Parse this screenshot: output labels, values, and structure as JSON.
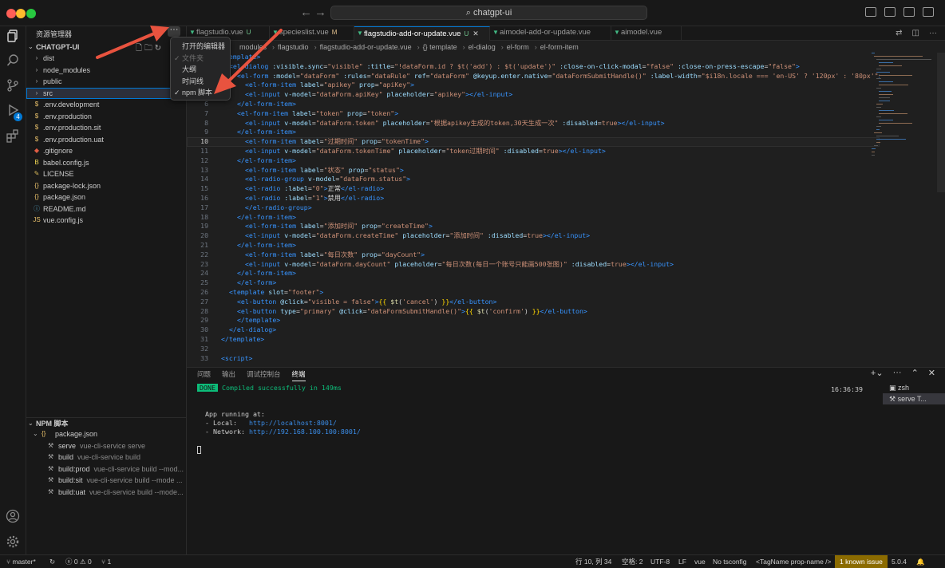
{
  "window": {
    "title": "chatgpt-ui"
  },
  "sidebar": {
    "title": "资源管理器",
    "more_label": "···",
    "project": "CHATGPT-UI",
    "tree": [
      {
        "name": "dist",
        "kind": "folder"
      },
      {
        "name": "node_modules",
        "kind": "folder"
      },
      {
        "name": "public",
        "kind": "folder"
      },
      {
        "name": "src",
        "kind": "folder",
        "selected": true
      },
      {
        "name": ".env.development",
        "kind": "env"
      },
      {
        "name": ".env.production",
        "kind": "env"
      },
      {
        "name": ".env.production.sit",
        "kind": "env"
      },
      {
        "name": ".env.production.uat",
        "kind": "env"
      },
      {
        "name": ".gitignore",
        "kind": "git"
      },
      {
        "name": "babel.config.js",
        "kind": "babel"
      },
      {
        "name": "LICENSE",
        "kind": "license"
      },
      {
        "name": "package-lock.json",
        "kind": "json"
      },
      {
        "name": "package.json",
        "kind": "json"
      },
      {
        "name": "README.md",
        "kind": "info"
      },
      {
        "name": "vue.config.js",
        "kind": "js"
      }
    ],
    "npm": {
      "title": "NPM 脚本",
      "package": "package.json",
      "scripts": [
        {
          "name": "serve",
          "cmd": "vue-cli-service serve"
        },
        {
          "name": "build",
          "cmd": "vue-cli-service build"
        },
        {
          "name": "build:prod",
          "cmd": "vue-cli-service build --mod..."
        },
        {
          "name": "build:sit",
          "cmd": "vue-cli-service build --mode ..."
        },
        {
          "name": "build:uat",
          "cmd": "vue-cli-service build --mode..."
        }
      ]
    }
  },
  "context_menu": {
    "items": [
      {
        "label": "打开的编辑器",
        "checked": false,
        "disabled": false
      },
      {
        "label": "文件夹",
        "checked": true,
        "disabled": true
      },
      {
        "label": "大纲",
        "checked": false,
        "disabled": false
      },
      {
        "label": "时间线",
        "checked": false,
        "disabled": false
      },
      {
        "label": "npm 脚本",
        "checked": true,
        "disabled": false
      }
    ]
  },
  "tabs": [
    {
      "label": "flagstudio.vue",
      "mark": "U",
      "active": false
    },
    {
      "label": "specieslist.vue",
      "mark": "M",
      "active": false
    },
    {
      "label": "flagstudio-add-or-update.vue",
      "mark": "U",
      "active": true,
      "close": "✕"
    },
    {
      "label": "aimodel-add-or-update.vue",
      "mark": "",
      "active": false
    },
    {
      "label": "aimodel.vue",
      "mark": "",
      "active": false
    }
  ],
  "breadcrumb": [
    "modules",
    "flagstudio",
    "flagstudio-add-or-update.vue",
    "{} template",
    "el-dialog",
    "el-form",
    "el-form-item"
  ],
  "editor": {
    "current_line": 10,
    "lines": [
      {
        "n": 1,
        "i": 0,
        "t": [
          [
            "t",
            "<template>"
          ]
        ]
      },
      {
        "n": 2,
        "i": 1,
        "t": [
          [
            "t",
            "<el-dialog "
          ],
          [
            "a",
            ":visible.sync"
          ],
          [
            "x",
            "="
          ],
          [
            "s",
            "\"visible\" "
          ],
          [
            "a",
            ":title"
          ],
          [
            "x",
            "="
          ],
          [
            "s",
            "\"!dataForm.id ? $t('add') : $t('update')\" "
          ],
          [
            "a",
            ":close-on-click-modal"
          ],
          [
            "x",
            "="
          ],
          [
            "s",
            "\"false\" "
          ],
          [
            "a",
            ":close-on-press-escape"
          ],
          [
            "x",
            "="
          ],
          [
            "s",
            "\"false\""
          ],
          [
            "t",
            ">"
          ]
        ]
      },
      {
        "n": 3,
        "i": 2,
        "t": [
          [
            "t",
            "<el-form "
          ],
          [
            "a",
            ":model"
          ],
          [
            "x",
            "="
          ],
          [
            "s",
            "\"dataForm\" "
          ],
          [
            "a",
            ":rules"
          ],
          [
            "x",
            "="
          ],
          [
            "s",
            "\"dataRule\" "
          ],
          [
            "a",
            "ref"
          ],
          [
            "x",
            "="
          ],
          [
            "s",
            "\"dataForm\" "
          ],
          [
            "a",
            "@keyup.enter.native"
          ],
          [
            "x",
            "="
          ],
          [
            "s",
            "\"dataFormSubmitHandle()\" "
          ],
          [
            "a",
            ":label-width"
          ],
          [
            "x",
            "="
          ],
          [
            "s",
            "\"$i18n.locale === 'en-US' ? '120px' : '80px'\""
          ],
          [
            "t",
            ">"
          ]
        ]
      },
      {
        "n": 4,
        "i": 3,
        "t": [
          [
            "t",
            "<el-form-item "
          ],
          [
            "a",
            "label"
          ],
          [
            "x",
            "="
          ],
          [
            "s",
            "\"apikey\" "
          ],
          [
            "a",
            "prop"
          ],
          [
            "x",
            "="
          ],
          [
            "s",
            "\"apiKey\""
          ],
          [
            "t",
            ">"
          ]
        ]
      },
      {
        "n": 5,
        "i": 3,
        "t": [
          [
            "t",
            "<el-input "
          ],
          [
            "a",
            "v-model"
          ],
          [
            "x",
            "="
          ],
          [
            "s",
            "\"dataForm.apiKey\" "
          ],
          [
            "a",
            "placeholder"
          ],
          [
            "x",
            "="
          ],
          [
            "s",
            "\"apikey\""
          ],
          [
            "t",
            "></el-input>"
          ]
        ]
      },
      {
        "n": 6,
        "i": 2,
        "t": [
          [
            "t",
            "</el-form-item>"
          ]
        ]
      },
      {
        "n": 7,
        "i": 2,
        "t": [
          [
            "t",
            "<el-form-item "
          ],
          [
            "a",
            "label"
          ],
          [
            "x",
            "="
          ],
          [
            "s",
            "\"token\" "
          ],
          [
            "a",
            "prop"
          ],
          [
            "x",
            "="
          ],
          [
            "s",
            "\"token\""
          ],
          [
            "t",
            ">"
          ]
        ]
      },
      {
        "n": 8,
        "i": 3,
        "t": [
          [
            "t",
            "<el-input "
          ],
          [
            "a",
            "v-model"
          ],
          [
            "x",
            "="
          ],
          [
            "s",
            "\"dataForm.token\" "
          ],
          [
            "a",
            "placeholder"
          ],
          [
            "x",
            "="
          ],
          [
            "s",
            "\"根据apikey生成的token,30天生成一次\" "
          ],
          [
            "a",
            ":disabled"
          ],
          [
            "x",
            "="
          ],
          [
            "s",
            "true"
          ],
          [
            "t",
            "></el-input>"
          ]
        ]
      },
      {
        "n": 9,
        "i": 2,
        "t": [
          [
            "t",
            "</el-form-item>"
          ]
        ]
      },
      {
        "n": 10,
        "i": 3,
        "t": [
          [
            "t",
            "<el-form-item "
          ],
          [
            "a",
            "label"
          ],
          [
            "x",
            "="
          ],
          [
            "s",
            "\"过期时间\" "
          ],
          [
            "a",
            "prop"
          ],
          [
            "x",
            "="
          ],
          [
            "s",
            "\"tokenTime\""
          ],
          [
            "t",
            ">"
          ]
        ]
      },
      {
        "n": 11,
        "i": 3,
        "t": [
          [
            "t",
            "<el-input "
          ],
          [
            "a",
            "v-model"
          ],
          [
            "x",
            "="
          ],
          [
            "s",
            "\"dataForm.tokenTime\" "
          ],
          [
            "a",
            "placeholder"
          ],
          [
            "x",
            "="
          ],
          [
            "s",
            "\"token过期时间\" "
          ],
          [
            "a",
            ":disabled"
          ],
          [
            "x",
            "="
          ],
          [
            "s",
            "true"
          ],
          [
            "t",
            "></el-input>"
          ]
        ]
      },
      {
        "n": 12,
        "i": 2,
        "t": [
          [
            "t",
            "</el-form-item>"
          ]
        ]
      },
      {
        "n": 13,
        "i": 3,
        "t": [
          [
            "t",
            "<el-form-item "
          ],
          [
            "a",
            "label"
          ],
          [
            "x",
            "="
          ],
          [
            "s",
            "\"状态\" "
          ],
          [
            "a",
            "prop"
          ],
          [
            "x",
            "="
          ],
          [
            "s",
            "\"status\""
          ],
          [
            "t",
            ">"
          ]
        ]
      },
      {
        "n": 14,
        "i": 3,
        "t": [
          [
            "t",
            "<el-radio-group "
          ],
          [
            "a",
            "v-model"
          ],
          [
            "x",
            "="
          ],
          [
            "s",
            "\"dataForm.status\""
          ],
          [
            "t",
            ">"
          ]
        ]
      },
      {
        "n": 15,
        "i": 3,
        "t": [
          [
            "t",
            "<el-radio "
          ],
          [
            "a",
            ":label"
          ],
          [
            "x",
            "="
          ],
          [
            "s",
            "\"0\""
          ],
          [
            "t",
            ">"
          ],
          [
            "x",
            "正常"
          ],
          [
            "t",
            "</el-radio>"
          ]
        ]
      },
      {
        "n": 16,
        "i": 3,
        "t": [
          [
            "t",
            "<el-radio "
          ],
          [
            "a",
            ":label"
          ],
          [
            "x",
            "="
          ],
          [
            "s",
            "\"1\""
          ],
          [
            "t",
            ">"
          ],
          [
            "x",
            "禁用"
          ],
          [
            "t",
            "</el-radio>"
          ]
        ]
      },
      {
        "n": 17,
        "i": 2,
        "t": [
          [
            "t",
            "  </el-radio-group>"
          ]
        ]
      },
      {
        "n": 18,
        "i": 2,
        "t": [
          [
            "t",
            "</el-form-item>"
          ]
        ]
      },
      {
        "n": 19,
        "i": 3,
        "t": [
          [
            "t",
            "<el-form-item "
          ],
          [
            "a",
            "label"
          ],
          [
            "x",
            "="
          ],
          [
            "s",
            "\"添加时间\" "
          ],
          [
            "a",
            "prop"
          ],
          [
            "x",
            "="
          ],
          [
            "s",
            "\"createTime\""
          ],
          [
            "t",
            ">"
          ]
        ]
      },
      {
        "n": 20,
        "i": 3,
        "t": [
          [
            "t",
            "<el-input "
          ],
          [
            "a",
            "v-model"
          ],
          [
            "x",
            "="
          ],
          [
            "s",
            "\"dataForm.createTime\" "
          ],
          [
            "a",
            "placeholder"
          ],
          [
            "x",
            "="
          ],
          [
            "s",
            "\"添加时间\" "
          ],
          [
            "a",
            ":disabled"
          ],
          [
            "x",
            "="
          ],
          [
            "s",
            "true"
          ],
          [
            "t",
            "></el-input>"
          ]
        ]
      },
      {
        "n": 21,
        "i": 2,
        "t": [
          [
            "t",
            "</el-form-item>"
          ]
        ]
      },
      {
        "n": 22,
        "i": 3,
        "t": [
          [
            "t",
            "<el-form-item "
          ],
          [
            "a",
            "label"
          ],
          [
            "x",
            "="
          ],
          [
            "s",
            "\"每日次数\" "
          ],
          [
            "a",
            "prop"
          ],
          [
            "x",
            "="
          ],
          [
            "s",
            "\"dayCount\""
          ],
          [
            "t",
            ">"
          ]
        ]
      },
      {
        "n": 23,
        "i": 3,
        "t": [
          [
            "t",
            "<el-input "
          ],
          [
            "a",
            "v-model"
          ],
          [
            "x",
            "="
          ],
          [
            "s",
            "\"dataForm.dayCount\" "
          ],
          [
            "a",
            "placeholder"
          ],
          [
            "x",
            "="
          ],
          [
            "s",
            "\"每日次数(每日一个账号只能画500张图)\" "
          ],
          [
            "a",
            ":disabled"
          ],
          [
            "x",
            "="
          ],
          [
            "s",
            "true"
          ],
          [
            "t",
            "></el-input>"
          ]
        ]
      },
      {
        "n": 24,
        "i": 2,
        "t": [
          [
            "t",
            "</el-form-item>"
          ]
        ]
      },
      {
        "n": 25,
        "i": 2,
        "t": [
          [
            "t",
            "</el-form>"
          ]
        ]
      },
      {
        "n": 26,
        "i": 1,
        "t": [
          [
            "t",
            "<template "
          ],
          [
            "a",
            "slot"
          ],
          [
            "x",
            "="
          ],
          [
            "s",
            "\"footer\""
          ],
          [
            "t",
            ">"
          ]
        ]
      },
      {
        "n": 27,
        "i": 2,
        "t": [
          [
            "t",
            "<el-button "
          ],
          [
            "a",
            "@click"
          ],
          [
            "x",
            "="
          ],
          [
            "s",
            "\"visible = false\""
          ],
          [
            "t",
            ">"
          ],
          [
            "y",
            "{{ "
          ],
          [
            "f",
            "$t"
          ],
          [
            "x",
            "("
          ],
          [
            "s",
            "'cancel'"
          ],
          [
            "x",
            ")"
          ],
          [
            "y",
            " }}"
          ],
          [
            "t",
            "</el-button>"
          ]
        ]
      },
      {
        "n": 28,
        "i": 2,
        "t": [
          [
            "t",
            "<el-button "
          ],
          [
            "a",
            "type"
          ],
          [
            "x",
            "="
          ],
          [
            "s",
            "\"primary\" "
          ],
          [
            "a",
            "@click"
          ],
          [
            "x",
            "="
          ],
          [
            "s",
            "\"dataFormSubmitHandle()\""
          ],
          [
            "t",
            ">"
          ],
          [
            "y",
            "{{ "
          ],
          [
            "f",
            "$t"
          ],
          [
            "x",
            "("
          ],
          [
            "s",
            "'confirm'"
          ],
          [
            "x",
            ")"
          ],
          [
            "y",
            " }}"
          ],
          [
            "t",
            "</el-button>"
          ]
        ]
      },
      {
        "n": 29,
        "i": 2,
        "t": [
          [
            "t",
            "</template>"
          ]
        ]
      },
      {
        "n": 30,
        "i": 1,
        "t": [
          [
            "t",
            "</el-dialog>"
          ]
        ]
      },
      {
        "n": 31,
        "i": 0,
        "t": [
          [
            "t",
            "</template>"
          ]
        ]
      },
      {
        "n": 32,
        "i": 0,
        "t": []
      },
      {
        "n": 33,
        "i": 0,
        "t": [
          [
            "t",
            "<script>"
          ]
        ]
      }
    ]
  },
  "panel": {
    "tabs": [
      "问题",
      "输出",
      "调试控制台",
      "终端"
    ],
    "active_tab": "终端",
    "terminal": {
      "done_badge": "DONE",
      "compiled": "Compiled successfully in 149ms",
      "time": "16:36:39",
      "running": "App running at:",
      "local_label": "- Local:   ",
      "local_url": "http://localhost:8001/",
      "network_label": "- Network: ",
      "network_url": "http://192.168.100.100:8001/"
    },
    "terminals": [
      "zsh",
      "serve T..."
    ]
  },
  "status": {
    "branch": "master*",
    "errors": "0",
    "warnings": "0",
    "ports": "1",
    "position": "行 10, 列 34",
    "spaces": "空格: 2",
    "encoding": "UTF-8",
    "eol": "LF",
    "language": "vue",
    "tsconfig": "No tsconfig",
    "tag": "<TagName prop-name />",
    "known_issue": "1 known issue",
    "version": "5.0.4"
  },
  "colors": {
    "accent": "#0078d4",
    "vue": "#41b883",
    "annotation_arrow": "#e8533f",
    "terminal_done": "#0dbc79"
  }
}
